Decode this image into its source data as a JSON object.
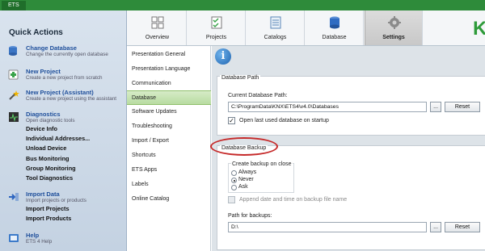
{
  "app": {
    "tab_label": "ETS"
  },
  "sidebar": {
    "title": "Quick Actions",
    "actions": [
      {
        "title": "Change Database",
        "desc": "Change the currently open database",
        "icon": "database-change-icon"
      },
      {
        "title": "New Project",
        "desc": "Create a new project from scratch",
        "icon": "new-project-icon"
      },
      {
        "title": "New Project (Assistant)",
        "desc": "Create a new project using the assistant",
        "icon": "wizard-icon"
      },
      {
        "title": "Diagnostics",
        "desc": "Open diagnostic tools",
        "icon": "diagnostics-icon"
      },
      {
        "title": "Import Data",
        "desc": "Import projects or products",
        "icon": "import-icon"
      },
      {
        "title": "Help",
        "desc": "ETS 4 Help",
        "icon": "help-icon"
      }
    ],
    "diagnostics_items": [
      "Device Info",
      "Individual Addresses...",
      "Unload Device",
      "Bus Monitoring",
      "Group Monitoring",
      "Tool Diagnostics"
    ],
    "import_items": [
      "Import Projects",
      "Import Products"
    ]
  },
  "topnav": {
    "tabs": [
      {
        "label": "Overview",
        "icon": "overview-icon"
      },
      {
        "label": "Projects",
        "icon": "projects-icon"
      },
      {
        "label": "Catalogs",
        "icon": "catalogs-icon"
      },
      {
        "label": "Database",
        "icon": "database-icon"
      },
      {
        "label": "Settings",
        "icon": "settings-gear-icon"
      }
    ],
    "active": "Settings",
    "brand_letter": "K"
  },
  "settings": {
    "categories": [
      "Presentation General",
      "Presentation Language",
      "Communication",
      "Database",
      "Software Updates",
      "Troubleshooting",
      "Import / Export",
      "Shortcuts",
      "ETS Apps",
      "Labels",
      "Online Catalog"
    ],
    "active_category": "Database"
  },
  "database_path": {
    "legend": "Database Path",
    "current_label": "Current Database Path:",
    "current_value": "C:\\ProgramData\\KNX\\ETS4\\v4.0\\Databases",
    "browse_label": "...",
    "reset_label": "Reset",
    "open_last_label": "Open last used database on startup",
    "open_last_checked": true
  },
  "backup": {
    "legend": "Database Backup",
    "create_label": "Create backup on close",
    "options": [
      "Always",
      "Never",
      "Ask"
    ],
    "selected": "Never",
    "append_label": "Append date and time on backup file name",
    "append_checked": false,
    "path_label": "Path for backups:",
    "path_value": "D:\\",
    "browse_label": "...",
    "reset_label": "Reset"
  },
  "colors": {
    "title_green": "#2e8b3a",
    "link_blue": "#1f4f9b",
    "active_green": "#b8dca1",
    "highlight_red": "#c62a2a"
  }
}
